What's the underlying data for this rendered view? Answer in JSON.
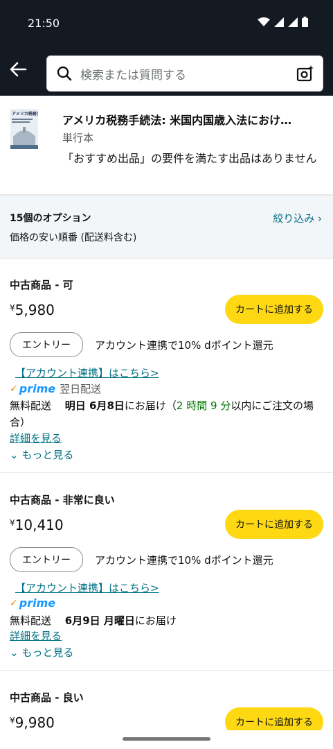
{
  "status": {
    "time": "21:50"
  },
  "search": {
    "placeholder": "検索または質問する"
  },
  "product": {
    "title": "アメリカ税務手続法: 米国内国歳入法におけ…",
    "format": "単行本",
    "notice": "「おすすめ出品」の要件を満たす出品はありません",
    "thumb_text": "アメリカ税務手続法"
  },
  "options": {
    "count": "15個のオプション",
    "sort": "価格の安い順番 (配送料含む)",
    "filter": "絞り込み ›"
  },
  "offers": [
    {
      "condition": "中古商品 - 可",
      "price_symbol": "¥",
      "price": "5,980",
      "cart": "カートに追加する",
      "entry": "エントリー",
      "dpoint": "アカウント連携で10% dポイント還元",
      "link": "【アカウント連携】はこちら>",
      "prime": "prime",
      "prime_next": "翌日配送",
      "delivery_prefix": "無料配送",
      "delivery_bold": "明日 6月8日",
      "delivery_mid": "にお届け（",
      "delivery_green": "2 時間 9 分",
      "delivery_suffix": "以内にご注文の場合）",
      "details": "詳細を見る",
      "more": "もっと見る"
    },
    {
      "condition": "中古商品 - 非常に良い",
      "price_symbol": "¥",
      "price": "10,410",
      "cart": "カートに追加する",
      "entry": "エントリー",
      "dpoint": "アカウント連携で10% dポイント還元",
      "link": "【アカウント連携】はこちら>",
      "prime": "prime",
      "delivery_prefix": "無料配送",
      "delivery_bold": "6月9日 月曜日",
      "delivery_mid": "にお届け",
      "details": "詳細を見る",
      "more": "もっと見る"
    },
    {
      "condition": "中古商品 - 良い",
      "price_symbol": "¥",
      "price": "9,980",
      "cart": "カートに追加する"
    }
  ],
  "colors": {
    "header_bg": "#131a22",
    "cart_yellow": "#ffd814",
    "link_teal": "#007185",
    "prime_blue": "#1a98ff",
    "green": "#007600"
  }
}
